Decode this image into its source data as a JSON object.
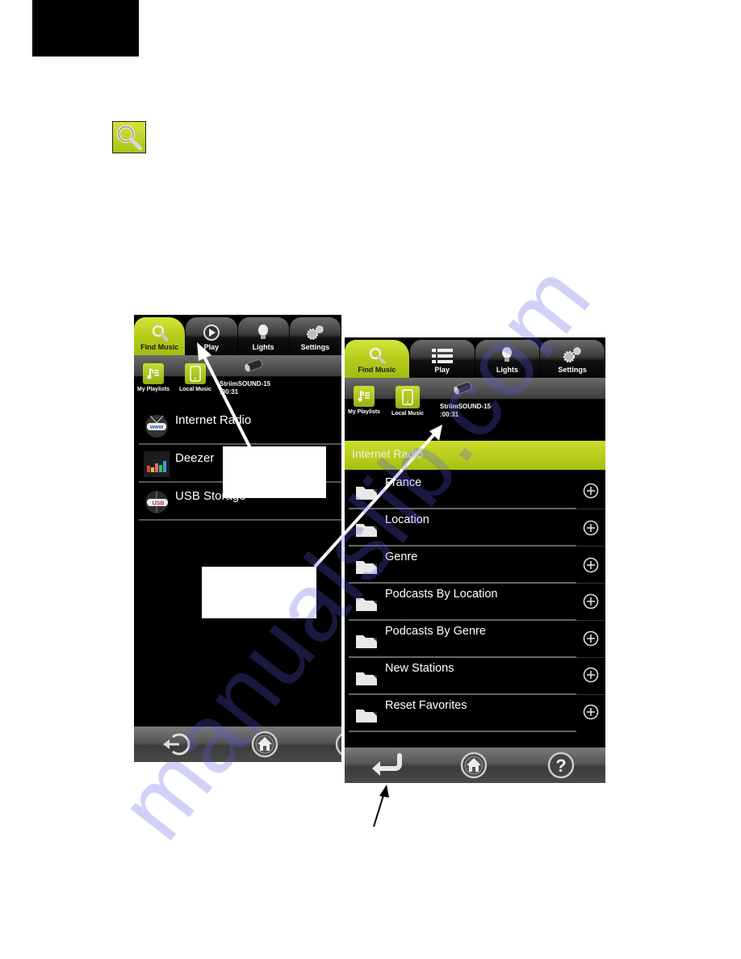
{
  "page": {
    "watermark": "manualslib.com"
  },
  "left_screen": {
    "tabs": [
      {
        "label": "Find Music",
        "icon": "search-icon",
        "active": true
      },
      {
        "label": "Play",
        "icon": "play-circle-icon",
        "active": false
      },
      {
        "label": "Lights",
        "icon": "lightbulb-icon",
        "active": false
      },
      {
        "label": "Settings",
        "icon": "gears-icon",
        "active": false
      }
    ],
    "sources": [
      {
        "label": "My Playlists",
        "icon": "playlist-icon"
      },
      {
        "label": "Local Music",
        "icon": "phone-icon"
      }
    ],
    "device": {
      "name": "StriimSOUND-15",
      "time": ":00:31",
      "icon": "speaker-icon"
    },
    "items": [
      {
        "label": "Internet Radio",
        "icon": "www-radio-icon"
      },
      {
        "label": "Deezer",
        "icon": "deezer-icon"
      },
      {
        "label": "USB Storage",
        "icon": "usb-icon"
      }
    ],
    "nav": [
      {
        "icon": "back-icon"
      },
      {
        "icon": "home-icon"
      },
      {
        "icon": "help-icon"
      }
    ]
  },
  "right_screen": {
    "tabs": [
      {
        "label": "Find Music",
        "icon": "search-icon",
        "active": true
      },
      {
        "label": "Play",
        "icon": "list-icon",
        "active": false
      },
      {
        "label": "Lights",
        "icon": "lightbulb-icon",
        "active": false
      },
      {
        "label": "Settings",
        "icon": "gears-icon",
        "active": false
      }
    ],
    "sources": [
      {
        "label": "My Playlists",
        "icon": "playlist-icon"
      },
      {
        "label": "Local Music",
        "icon": "phone-icon"
      }
    ],
    "device": {
      "name": "StriimSOUND-15",
      "time": ":00:31",
      "icon": "speaker-icon"
    },
    "section_title": "Internet Radio",
    "items": [
      {
        "label": "France"
      },
      {
        "label": "Location"
      },
      {
        "label": "Genre"
      },
      {
        "label": "Podcasts By Location"
      },
      {
        "label": "Podcasts By Genre"
      },
      {
        "label": "New Stations"
      },
      {
        "label": "Reset Favorites"
      }
    ],
    "nav": [
      {
        "icon": "return-icon"
      },
      {
        "icon": "home-icon"
      },
      {
        "icon": "help-icon"
      }
    ]
  },
  "colors": {
    "accent_green": "#b4cc1c",
    "screen_bg": "#000000",
    "page_bg": "#ffffff"
  }
}
